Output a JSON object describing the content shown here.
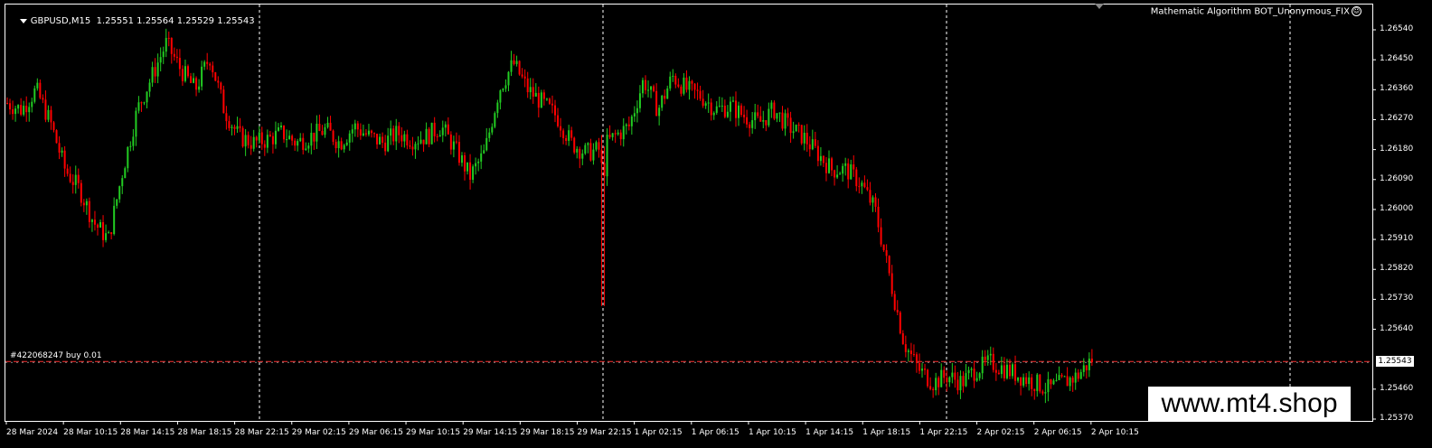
{
  "header": {
    "symbol": "GBPUSD,M15",
    "ohlc": "1.25551 1.25564 1.25529 1.25543"
  },
  "expert_label": "Mathematic Algorithm BOT_Unonymous_FIX",
  "order_line": {
    "label": "#422068247 buy 0.01",
    "price": "1.25543",
    "color": "#ff3030"
  },
  "watermark": "www.mt4.shop",
  "colors": {
    "background": "#000000",
    "bull": "#22cc22",
    "bear": "#ff0000",
    "grid": "#ffffff"
  },
  "price_axis": [
    "1.26540",
    "1.26450",
    "1.26360",
    "1.26270",
    "1.26180",
    "1.26090",
    "1.26000",
    "1.25910",
    "1.25820",
    "1.25730",
    "1.25640",
    "1.25460",
    "1.25370"
  ],
  "time_axis": [
    "28 Mar 2024",
    "28 Mar 10:15",
    "28 Mar 14:15",
    "28 Mar 18:15",
    "28 Mar 22:15",
    "29 Mar 02:15",
    "29 Mar 06:15",
    "29 Mar 10:15",
    "29 Mar 14:15",
    "29 Mar 18:15",
    "29 Mar 22:15",
    "1 Apr 02:15",
    "1 Apr 06:15",
    "1 Apr 10:15",
    "1 Apr 14:15",
    "1 Apr 18:15",
    "1 Apr 22:15",
    "2 Apr 02:15",
    "2 Apr 06:15",
    "2 Apr 10:15"
  ],
  "chart_data": {
    "type": "candlestick",
    "symbol": "GBPUSD",
    "timeframe": "M15",
    "ylim": [
      1.2535,
      1.2658
    ],
    "price_ticks": [
      1.2654,
      1.2645,
      1.2636,
      1.2627,
      1.2618,
      1.2609,
      1.26,
      1.2591,
      1.2582,
      1.2573,
      1.2564,
      1.2546,
      1.2537
    ],
    "time_labels": [
      "28 Mar 2024",
      "28 Mar 10:15",
      "28 Mar 14:15",
      "28 Mar 18:15",
      "28 Mar 22:15",
      "29 Mar 02:15",
      "29 Mar 06:15",
      "29 Mar 10:15",
      "29 Mar 14:15",
      "29 Mar 18:15",
      "29 Mar 22:15",
      "1 Apr 02:15",
      "1 Apr 06:15",
      "1 Apr 10:15",
      "1 Apr 14:15",
      "1 Apr 18:15",
      "1 Apr 22:15",
      "2 Apr 02:15",
      "2 Apr 06:15",
      "2 Apr 10:15"
    ],
    "close_path": [
      1.2632,
      1.263,
      1.2636,
      1.2626,
      1.2612,
      1.2606,
      1.2596,
      1.2591,
      1.2612,
      1.263,
      1.264,
      1.265,
      1.2642,
      1.2636,
      1.2646,
      1.263,
      1.2622,
      1.262,
      1.2621,
      1.2623,
      1.262,
      1.2622,
      1.2624,
      1.262,
      1.2625,
      1.2622,
      1.262,
      1.2623,
      1.2621,
      1.2622,
      1.2625,
      1.2618,
      1.261,
      1.2617,
      1.2636,
      1.2644,
      1.2636,
      1.2632,
      1.2628,
      1.262,
      1.2617,
      1.2618,
      1.2622,
      1.2625,
      1.2639,
      1.263,
      1.264,
      1.2636,
      1.2634,
      1.263,
      1.2631,
      1.2628,
      1.2626,
      1.263,
      1.2625,
      1.2622,
      1.2617,
      1.2612,
      1.2612,
      1.2608,
      1.26,
      1.258,
      1.256,
      1.2552,
      1.2548,
      1.255,
      1.2548,
      1.2552,
      1.2554,
      1.2552,
      1.255,
      1.2548,
      1.2546,
      1.2548,
      1.255,
      1.2555
    ],
    "current_price": 1.25543,
    "order": {
      "id": "#422068247",
      "side": "buy",
      "lots": 0.01,
      "price": 1.25543
    }
  }
}
